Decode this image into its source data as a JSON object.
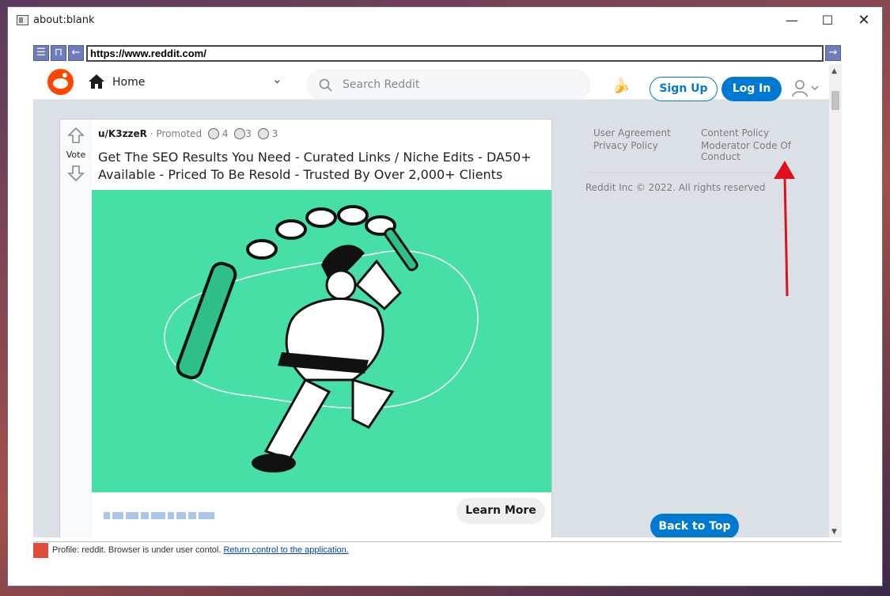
{
  "window": {
    "title": "about:blank",
    "min_icon": "minimize-icon",
    "max_icon": "maximize-icon",
    "close_icon": "close-icon"
  },
  "navbar": {
    "url": "https://www.reddit.com/",
    "buttons": [
      "menu-icon",
      "history-icon",
      "back-arrow-icon"
    ],
    "go_icon": "go-arrow-icon"
  },
  "reddit_header": {
    "home_label": "Home",
    "search_placeholder": "Search Reddit",
    "signup_label": "Sign Up",
    "login_label": "Log In",
    "banana_icon": "banana-icon"
  },
  "post": {
    "vote_label": "Vote",
    "username": "u/K3zzeR",
    "promoted": "Promoted",
    "award_counts": [
      "4",
      "3",
      "3"
    ],
    "title": "Get The SEO Results You Need - Curated Links / Niche Edits - DA50+ Available - Priced To Be Resold - Trusted By Over 2,000+ Clients",
    "cta_label": "Learn More",
    "image_bg": "#46e0a6"
  },
  "sidebar": {
    "links": [
      "User Agreement",
      "Privacy Policy",
      "Content Policy",
      "Moderator Code Of Conduct"
    ],
    "copyright": "Reddit Inc © 2022. All rights reserved",
    "back_to_top": "Back to Top"
  },
  "status_bar": {
    "text": "Profile: reddit. Browser is under user contol. ",
    "link": "Return control to the application."
  },
  "colors": {
    "reddit_blue": "#0079d3",
    "reddit_orange": "#ff4500",
    "annotation_red": "#e0101a"
  }
}
